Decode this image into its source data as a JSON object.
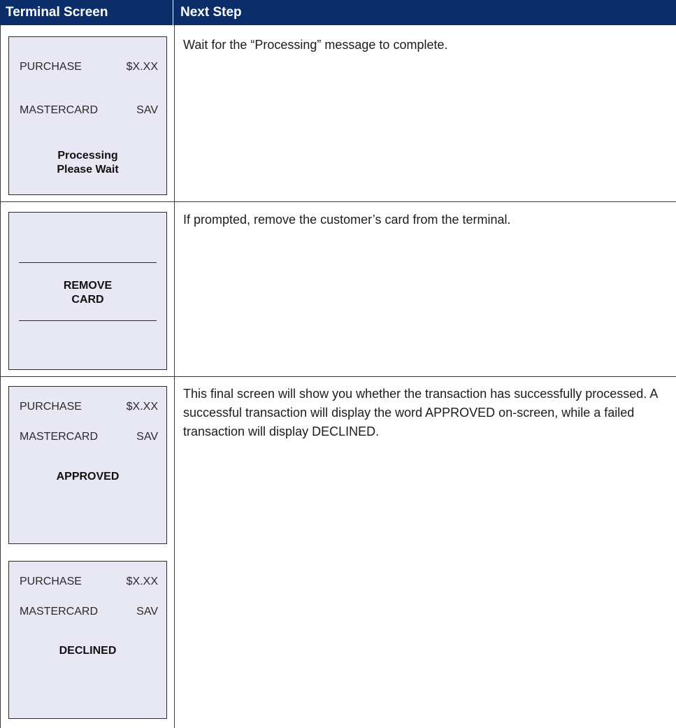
{
  "header": {
    "col1": "Terminal Screen",
    "col2": "Next Step"
  },
  "rows": [
    {
      "screens": [
        {
          "line1_left": "PURCHASE",
          "line1_right": "$X.XX",
          "line2_left": "MASTERCARD",
          "line2_right": "SAV",
          "message_line1": "Processing",
          "message_line2": "Please Wait"
        }
      ],
      "step": "Wait for the “Processing” message to complete."
    },
    {
      "screens": [
        {
          "message_line1": "REMOVE",
          "message_line2": "CARD"
        }
      ],
      "step": "If prompted, remove the customer’s card from the terminal."
    },
    {
      "screens": [
        {
          "line1_left": "PURCHASE",
          "line1_right": "$X.XX",
          "line2_left": "MASTERCARD",
          "line2_right": "SAV",
          "message_line1": "APPROVED"
        },
        {
          "line1_left": "PURCHASE",
          "line1_right": "$X.XX",
          "line2_left": "MASTERCARD",
          "line2_right": "SAV",
          "message_line1": "DECLINED"
        }
      ],
      "step": "This final screen will show you whether the transaction has successfully processed. A successful transaction will display the word APPROVED on-screen, while a failed transaction will display DECLINED."
    }
  ]
}
